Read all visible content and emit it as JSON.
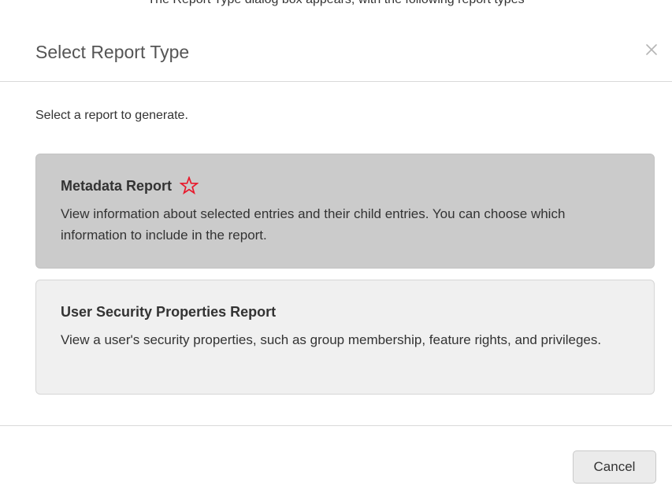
{
  "top_clipped_text": "The Report Type dialog box appears, with the following report types",
  "dialog": {
    "title": "Select Report Type",
    "close_icon": "close-icon",
    "intro": "Select a report to generate."
  },
  "options": [
    {
      "title": "Metadata Report",
      "description": "View information about selected entries and their child entries. You can choose which information to include in the report.",
      "selected": true,
      "marker_icon": "star-outline-icon",
      "marker_color": "#e8182b"
    },
    {
      "title": "User Security Properties Report",
      "description": "View a user's security properties, such as group membership, feature rights, and privileges.",
      "selected": false
    }
  ],
  "footer": {
    "cancel_label": "Cancel"
  },
  "colors": {
    "selected_option_bg": "#cbcbcb",
    "option_bg": "#f0f0f0",
    "title_text": "#555555",
    "body_text": "#333333"
  }
}
